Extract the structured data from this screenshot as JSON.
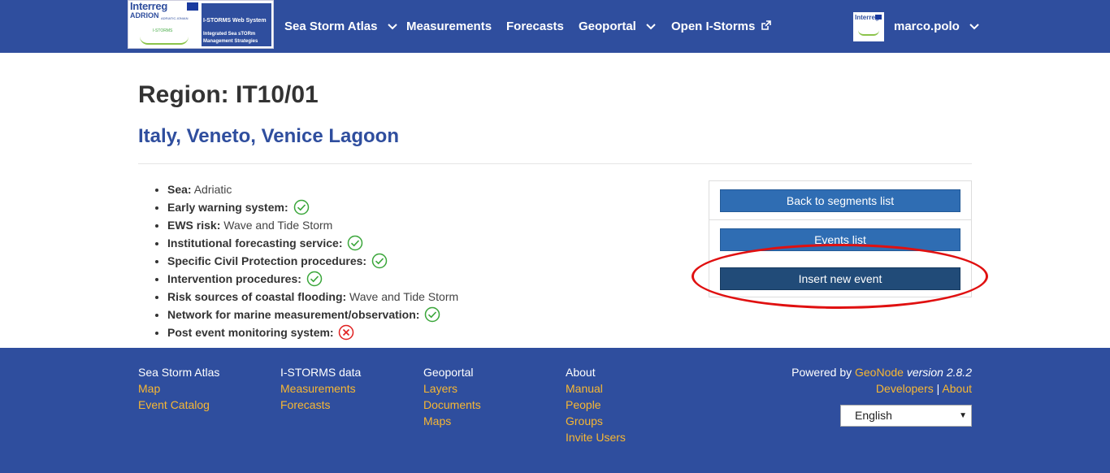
{
  "nav": {
    "brand": {
      "interreg": "Interreg",
      "adrion": "ADRION",
      "adriatic": "ADRIATIC-IONIAN",
      "istorms": "I-STORMS",
      "web_system": "I-STORMS Web System",
      "tagline": "Integrated Sea sTORm Management Strategies"
    },
    "items": [
      {
        "label": "Sea Storm Atlas"
      },
      {
        "label": "Measurements"
      },
      {
        "label": "Forecasts"
      },
      {
        "label": "Geoportal"
      },
      {
        "label": "Open I-Storms"
      }
    ],
    "user": {
      "name": "marco.polo"
    },
    "bg_color": "#2f4e9e"
  },
  "page": {
    "title": "Region: IT10/01",
    "subtitle": "Italy, Veneto, Venice Lagoon"
  },
  "info": [
    {
      "label": "Sea:",
      "value": "Adriatic",
      "status": null
    },
    {
      "label": "Early warning system:",
      "value": "",
      "status": "yes"
    },
    {
      "label": "EWS risk:",
      "value": "Wave and Tide Storm",
      "status": null
    },
    {
      "label": "Institutional forecasting service:",
      "value": "",
      "status": "yes"
    },
    {
      "label": "Specific Civil Protection procedures:",
      "value": "",
      "status": "yes"
    },
    {
      "label": "Intervention procedures:",
      "value": "",
      "status": "yes"
    },
    {
      "label": "Risk sources of coastal flooding:",
      "value": "Wave and Tide Storm",
      "status": null
    },
    {
      "label": "Network for marine measurement/observation:",
      "value": "",
      "status": "yes"
    },
    {
      "label": "Post event monitoring system:",
      "value": "",
      "status": "no"
    }
  ],
  "actions": {
    "back": "Back to segments list",
    "events": "Events list",
    "insert": "Insert new event"
  },
  "footer": {
    "cols": [
      {
        "heading": "Sea Storm Atlas",
        "links": [
          "Map",
          "Event Catalog"
        ]
      },
      {
        "heading": "I-STORMS data",
        "links": [
          "Measurements",
          "Forecasts"
        ]
      },
      {
        "heading": "Geoportal",
        "links": [
          "Layers",
          "Documents",
          "Maps"
        ]
      },
      {
        "heading": "About",
        "links": [
          "Manual",
          "People",
          "Groups",
          "Invite Users"
        ]
      }
    ],
    "powered_by": "Powered by",
    "geonode": "GeoNode",
    "version": "version 2.8.2",
    "developers": "Developers",
    "pipe": "|",
    "about": "About",
    "language": "English",
    "link_color": "#f7b733"
  },
  "colors": {
    "accent": "#2f4e9e",
    "check": "#3aa63a",
    "cross": "#e02020",
    "highlight": "#e01010"
  }
}
